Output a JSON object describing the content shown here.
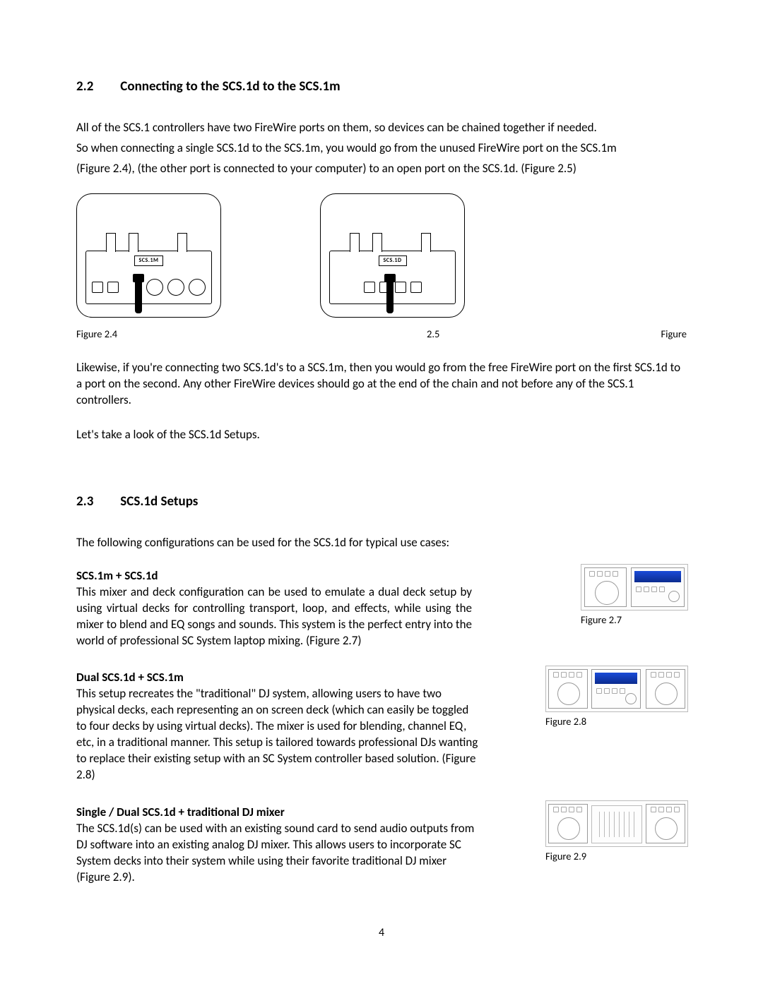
{
  "section22": {
    "num": "2.2",
    "title": "Connecting to the SCS.1d to the SCS.1m",
    "para1_l1": "All of the SCS.1 controllers have two FireWire ports on them, so devices can be chained together if needed.",
    "para1_l2": "So when connecting a single SCS.1d to the SCS.1m, you would go from the unused FireWire port on the SCS.1m",
    "para1_l3": "(Figure 2.4), (the other port is connected to your computer) to an open port on the SCS.1d. (Figure 2.5)",
    "device_a_label": "SCS.1M",
    "device_b_label": "SCS.1D",
    "caption_left": "Figure  2.4",
    "caption_mid": "2.5",
    "caption_right": "Figure",
    "para2": "Likewise, if you're connecting two SCS.1d's to a SCS.1m, then you would go from the free FireWire port on the first SCS.1d to a port on the second. Any other FireWire devices should go at the end of the chain and not before any of the SCS.1 controllers.",
    "para3": "Let's take a look of the SCS.1d Setups."
  },
  "section23": {
    "num": "2.3",
    "title": "SCS.1d Setups",
    "intro": "The following configurations can be used for the SCS.1d for typical use cases:",
    "s1": {
      "title": "SCS.1m + SCS.1d",
      "body": "This mixer and deck configuration can be used to emulate a dual deck setup by using virtual decks for controlling transport, loop, and effects, while using the mixer to blend and EQ songs and sounds. This system is the perfect entry into the world of professional SC System laptop mixing. (Figure 2.7)",
      "caption": "Figure  2.7"
    },
    "s2": {
      "title": "Dual SCS.1d + SCS.1m",
      "body": "This setup recreates the \"traditional\" DJ system, allowing users to have two physical decks, each representing an on screen deck (which can easily be toggled to four decks by using virtual decks). The mixer is used for blending, channel EQ, etc, in a traditional manner. This setup is tailored towards professional DJs wanting to replace their existing setup with an SC System controller based solution. (Figure 2.8)",
      "caption": "Figure  2.8"
    },
    "s3": {
      "title": "Single / Dual SCS.1d + traditional DJ mixer",
      "body": "The SCS.1d(s) can be used with an existing sound card to send audio outputs from DJ software into an existing analog DJ mixer. This allows users to incorporate SC System decks into their system while using their favorite traditional DJ mixer (Figure 2.9).",
      "caption": "Figure  2.9"
    }
  },
  "page_number": "4"
}
